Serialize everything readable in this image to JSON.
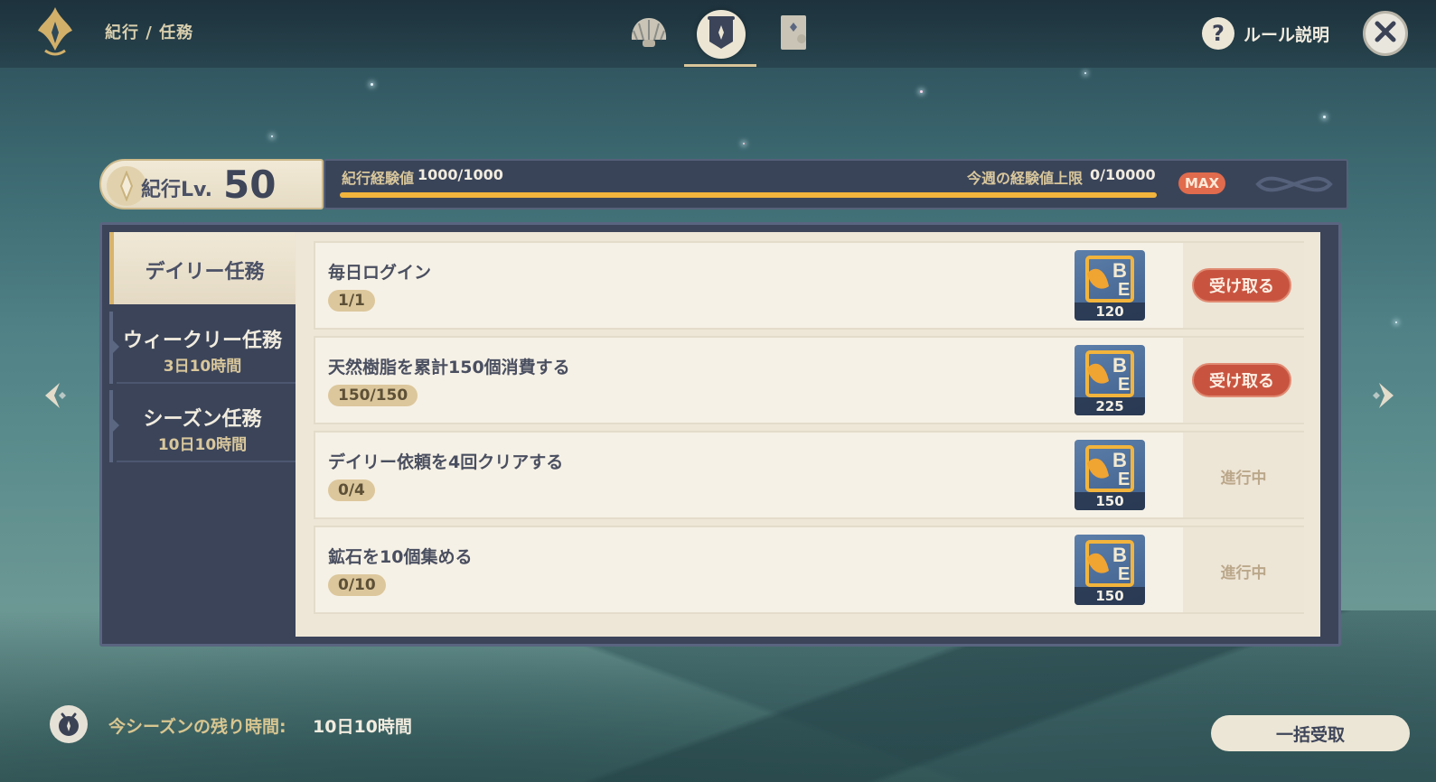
{
  "header": {
    "breadcrumb": "紀行 / 任務",
    "tabs": [
      {
        "icon": "shell-icon",
        "active": false
      },
      {
        "icon": "banner-icon",
        "active": true
      },
      {
        "icon": "card-icon",
        "active": false
      }
    ],
    "help_label": "ルール説明",
    "help_glyph": "?"
  },
  "level": {
    "label": "紀行Lv.",
    "value": "50",
    "exp_label": "紀行経験値",
    "exp_value": "1000/1000",
    "exp_fraction": 1.0,
    "weekly_cap_label": "今週の経験値上限",
    "weekly_cap_value": "0/10000",
    "max_badge": "MAX"
  },
  "sidebar": {
    "items": [
      {
        "label": "デイリー任務",
        "sub": "",
        "active": true
      },
      {
        "label": "ウィークリー任務",
        "sub": "3日10時間",
        "active": false
      },
      {
        "label": "シーズン任務",
        "sub": "10日10時間",
        "active": false
      }
    ]
  },
  "missions": [
    {
      "title": "毎日ログイン",
      "progress": "1/1",
      "reward_amount": "120",
      "status": "受け取る",
      "claimable": true
    },
    {
      "title": "天然樹脂を累計150個消費する",
      "progress": "150/150",
      "reward_amount": "225",
      "status": "受け取る",
      "claimable": true
    },
    {
      "title": "デイリー依頼を4回クリアする",
      "progress": "0/4",
      "reward_amount": "150",
      "status": "進行中",
      "claimable": false
    },
    {
      "title": "鉱石を10個集める",
      "progress": "0/10",
      "reward_amount": "150",
      "status": "進行中",
      "claimable": false
    }
  ],
  "footer": {
    "season_label": "今シーズンの残り時間:",
    "season_value": "10日10時間",
    "claim_all_label": "一括受取"
  },
  "colors": {
    "accent_gold": "#f2b43c",
    "claim_red": "#c85440",
    "panel_navy": "#3b4459",
    "parchment": "#f6f1e6"
  }
}
